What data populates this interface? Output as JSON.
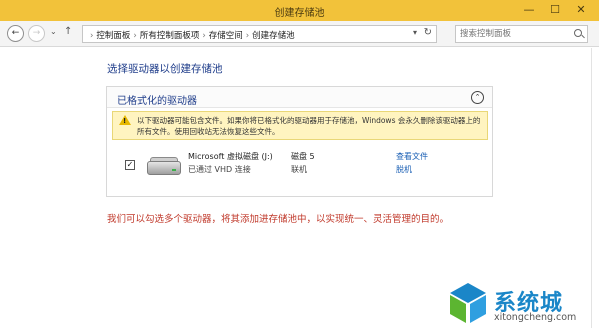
{
  "window": {
    "title": "创建存储池"
  },
  "titlebar": {
    "minimize": "—",
    "maximize": "☐",
    "close": "✕"
  },
  "nav": {
    "back": "←",
    "forward": "→",
    "recent": "⌄",
    "up": "↑",
    "breadcrumbs": [
      "控制面板",
      "所有控制面板项",
      "存储空间",
      "创建存储池"
    ],
    "separator": "›",
    "search_placeholder": "搜索控制面板"
  },
  "main": {
    "heading": "选择驱动器以创建存储池",
    "panel": {
      "title": "已格式化的驱动器",
      "collapse_icon": "⌃",
      "warning": "以下驱动器可能包含文件。如果你将已格式化的驱动器用于存储池，Windows 会永久删除该驱动器上的所有文件。使用回收站无法恢复这些文件。",
      "drive": {
        "checked": true,
        "check_mark": "✓",
        "name": "Microsoft 虚拟磁盘 (J:)",
        "connection": "已通过 VHD 连接",
        "disk_number": "磁盘 5",
        "status": "联机",
        "view_files_link": "查看文件",
        "offline_link": "脱机"
      }
    },
    "note": "我们可以勾选多个驱动器，将其添加进存储池中，以实现统一、灵活管理的目的。"
  },
  "watermark": {
    "brand": "系统城",
    "url": "xitongcheng.com",
    "colors": {
      "blue": "#1a86c8",
      "green": "#5cb531"
    }
  }
}
